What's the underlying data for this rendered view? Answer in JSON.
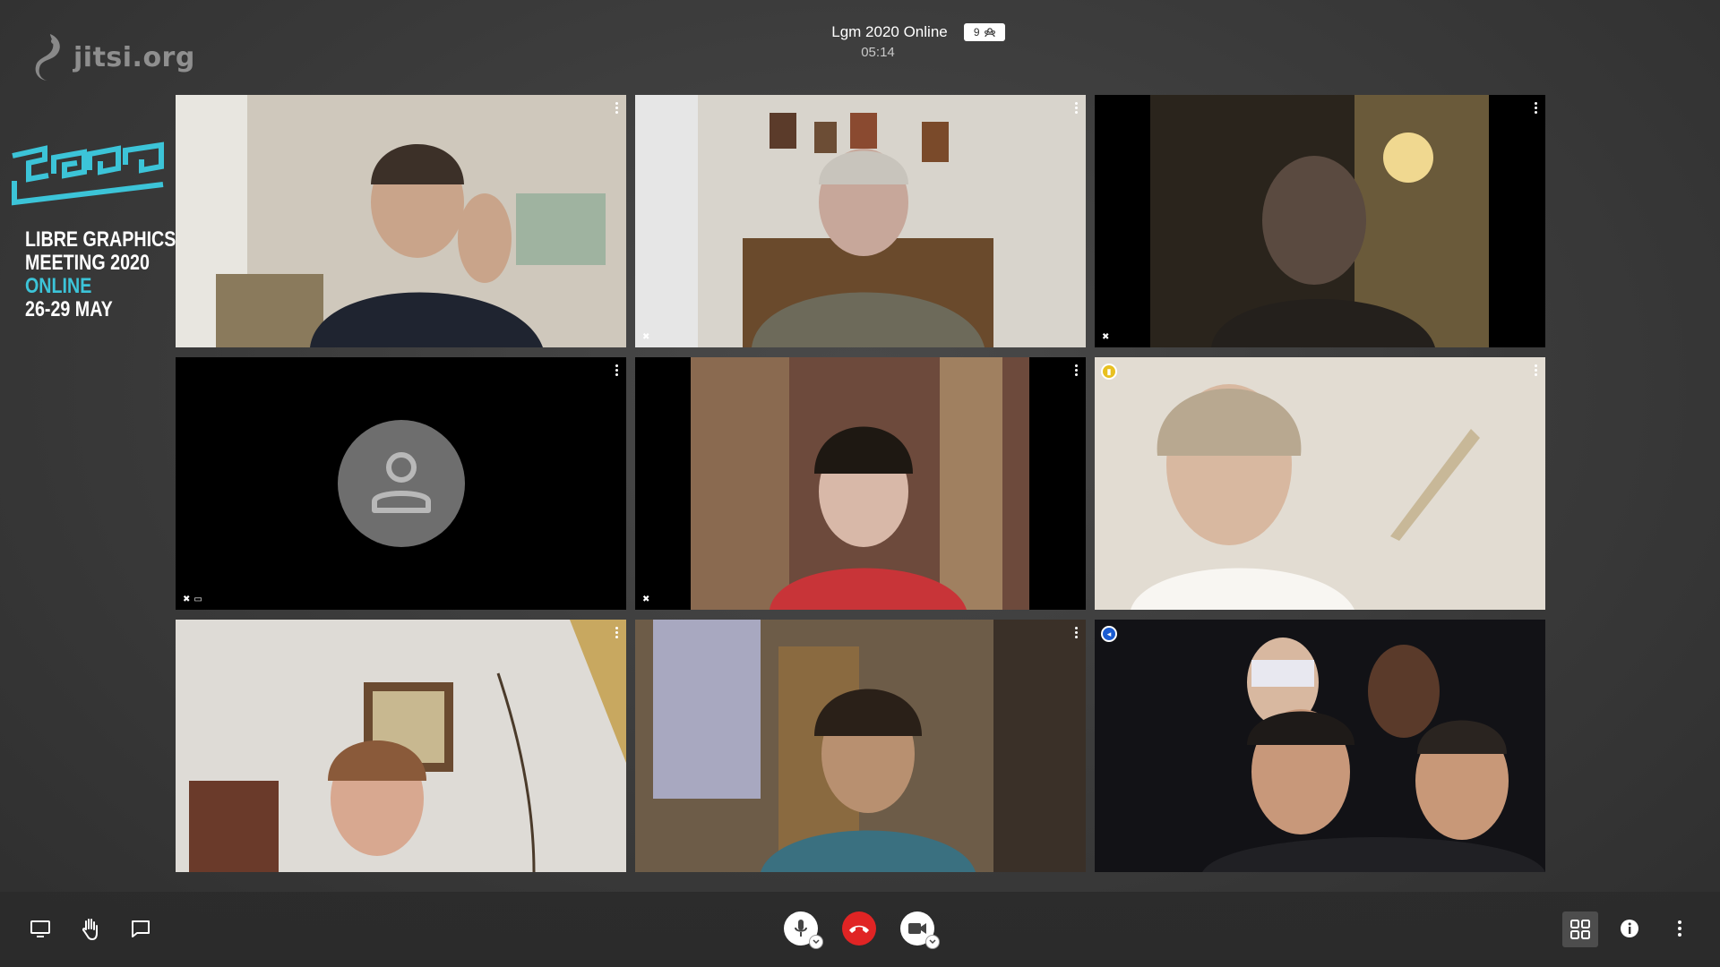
{
  "watermark": {
    "text": "jitsi.org"
  },
  "header": {
    "title": "Lgm 2020 Online",
    "participant_count": "9",
    "timer": "05:14"
  },
  "lgm_logo": {
    "line1": "LIBRE GRAPHICS",
    "line2": "MEETING 2020",
    "line3": "ONLINE",
    "line4": "26-29 MAY",
    "accent_color": "#3cc4d8"
  },
  "tiles": [
    {
      "id": "p1",
      "muted": false,
      "video_off": false,
      "active": false,
      "badge": "",
      "bg": "#c9c2b4"
    },
    {
      "id": "p2",
      "muted": true,
      "video_off": false,
      "active": false,
      "badge": "",
      "bg": "#a89a84"
    },
    {
      "id": "p3",
      "muted": true,
      "video_off": false,
      "active": false,
      "badge": "",
      "bg": "#2a221a"
    },
    {
      "id": "p4",
      "muted": true,
      "video_off": true,
      "active": false,
      "badge": "",
      "bg": "#000000"
    },
    {
      "id": "p5",
      "muted": true,
      "video_off": false,
      "active": false,
      "badge": "",
      "bg": "#6b4a3c"
    },
    {
      "id": "p6",
      "muted": false,
      "video_off": false,
      "active": false,
      "badge": "connection-warning",
      "bg": "#ddd6cc"
    },
    {
      "id": "p7",
      "muted": false,
      "video_off": false,
      "active": false,
      "badge": "",
      "bg": "#d9d6d0"
    },
    {
      "id": "p8",
      "muted": false,
      "video_off": false,
      "active": false,
      "badge": "",
      "bg": "#6d5c48"
    },
    {
      "id": "p9",
      "muted": false,
      "video_off": false,
      "active": true,
      "badge": "dominant-speaker",
      "bg": "#1a1a1a"
    }
  ],
  "toolbar": {
    "left": [
      "screen-share-icon",
      "raise-hand-icon",
      "chat-icon"
    ],
    "center": [
      "microphone-icon",
      "hangup-icon",
      "camera-icon"
    ],
    "right": [
      "tile-view-icon",
      "info-icon",
      "more-options-icon"
    ],
    "hangup_color": "#e02424",
    "active_border_color": "#1b5cd1"
  }
}
